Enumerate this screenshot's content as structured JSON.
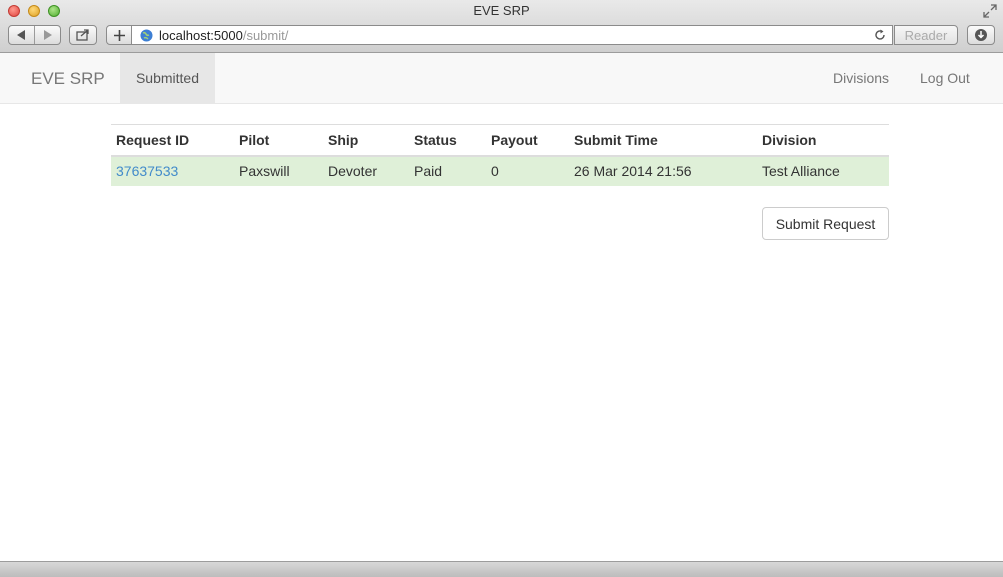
{
  "window": {
    "title": "EVE SRP"
  },
  "browser": {
    "url_host": "localhost:5000",
    "url_path": "/submit/",
    "reader_label": "Reader"
  },
  "navbar": {
    "brand": "EVE SRP",
    "active_tab": "Submitted",
    "right_items": [
      "Divisions",
      "Log Out"
    ]
  },
  "table": {
    "headers": [
      "Request ID",
      "Pilot",
      "Ship",
      "Status",
      "Payout",
      "Submit Time",
      "Division"
    ],
    "rows": [
      {
        "request_id": "37637533",
        "pilot": "Paxswill",
        "ship": "Devoter",
        "status": "Paid",
        "payout": "0",
        "submit_time": "26 Mar 2014 21:56",
        "division": "Test Alliance"
      }
    ],
    "row_status_color": "#dff0d8"
  },
  "actions": {
    "submit_label": "Submit Request"
  },
  "colors": {
    "link": "#428bca",
    "navbar_bg": "#f8f8f8",
    "active_tab_bg": "#e7e7e7"
  }
}
